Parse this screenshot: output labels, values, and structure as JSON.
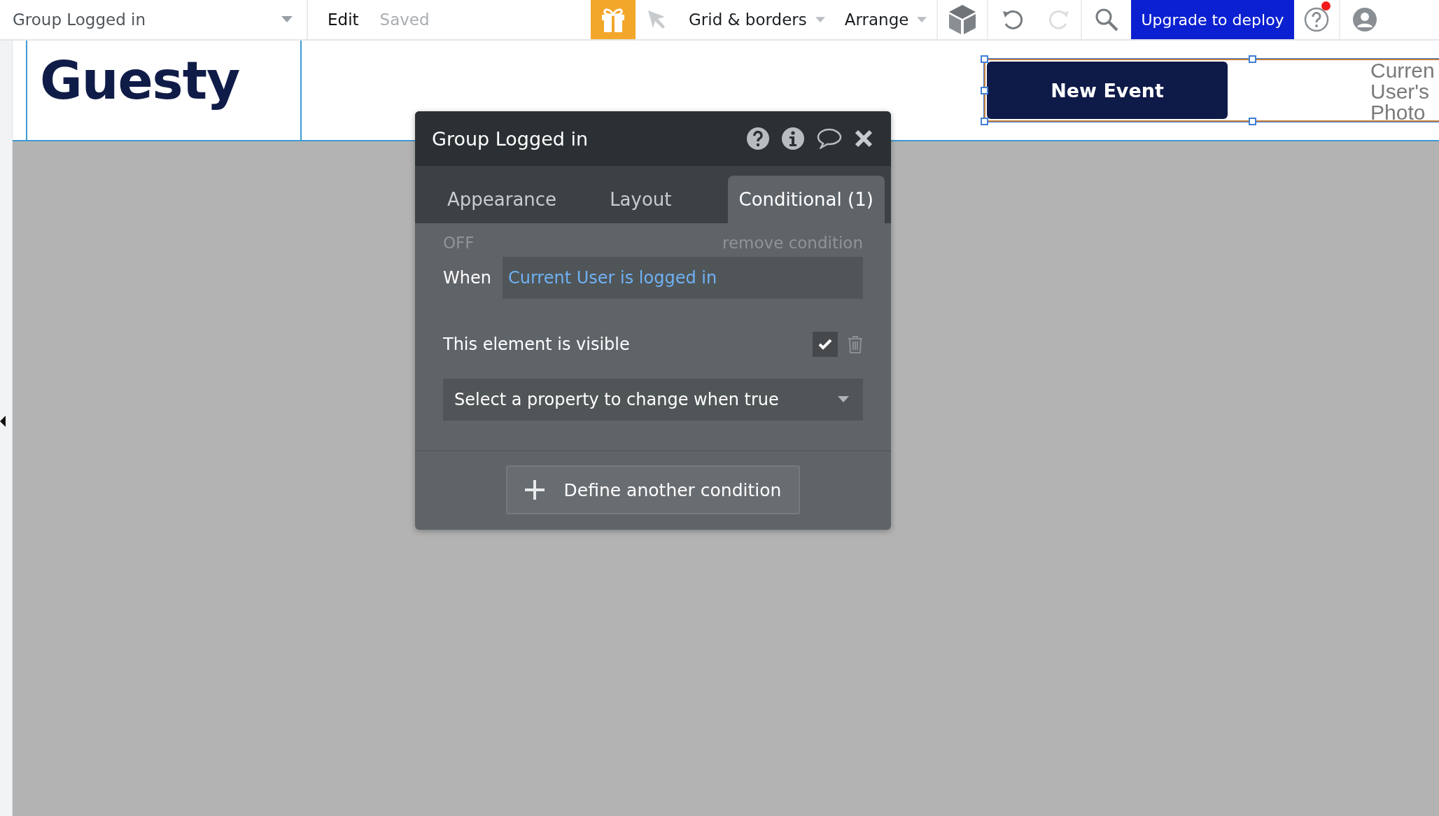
{
  "top_bar": {
    "element_selector": "Group Logged in",
    "edit_label": "Edit",
    "save_status": "Saved",
    "dropdowns": [
      "Grid & borders",
      "Arrange"
    ],
    "redo_disabled": true,
    "upgrade_button": "Upgrade to deploy",
    "help_notification": true
  },
  "canvas": {
    "logo": "Guesty",
    "button": "New Event",
    "photo_lines": [
      "Curren",
      "User's",
      "Photo"
    ]
  },
  "dialog": {
    "title": "Group Logged in",
    "tabs": [
      {
        "label": "Appearance",
        "selected": false
      },
      {
        "label": "Layout",
        "selected": false
      },
      {
        "label": "Conditional (1)",
        "selected": true
      }
    ],
    "condition": {
      "status": "OFF",
      "remove": "remove condition",
      "when_label": "When",
      "expression": "Current User is logged in",
      "property_label": "This element is visible",
      "checked": true,
      "select_placeholder": "Select a property to change when true"
    },
    "add_button": "Define another condition"
  }
}
